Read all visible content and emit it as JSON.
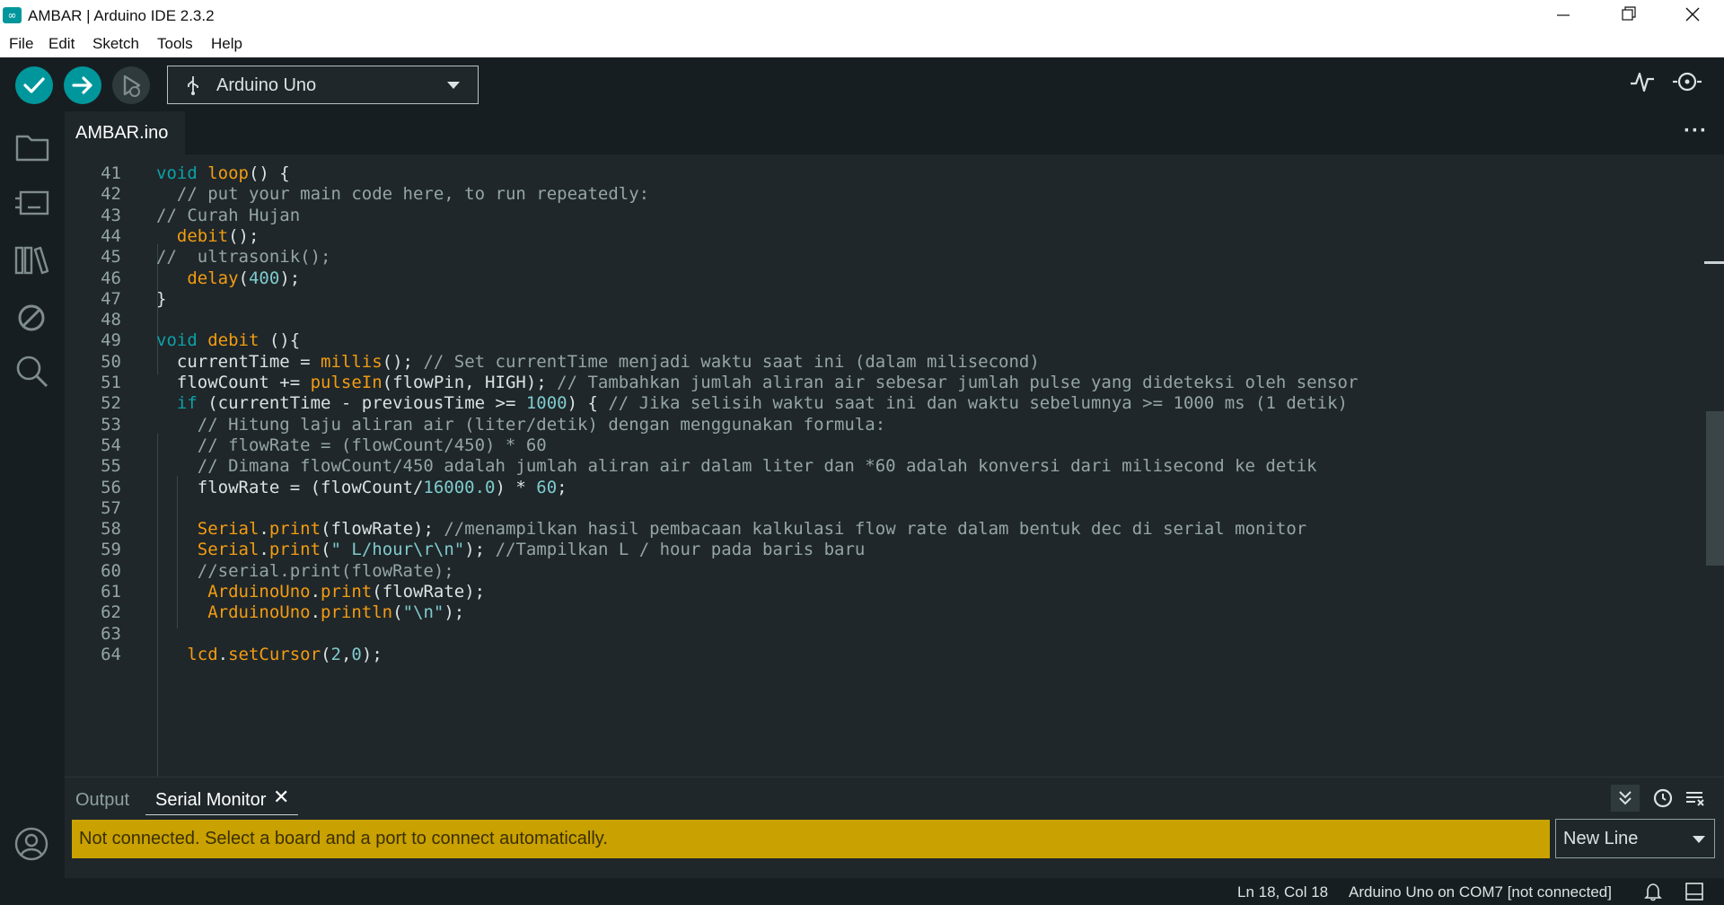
{
  "window": {
    "title": "AMBAR | Arduino IDE 2.3.2",
    "controls": [
      "minimize",
      "restore",
      "close"
    ]
  },
  "menu": [
    "File",
    "Edit",
    "Sketch",
    "Tools",
    "Help"
  ],
  "toolbar": {
    "verify": "verify-icon",
    "upload": "upload-icon",
    "debug": "debug-icon",
    "board": "Arduino Uno",
    "serial_plotter": "serial-plotter-icon",
    "serial_monitor": "serial-monitor-icon"
  },
  "sidebar": [
    "folder-icon",
    "boards-manager-icon",
    "library-icon",
    "debug-disabled-icon",
    "search-icon",
    "account-icon"
  ],
  "tabs": {
    "active": "AMBAR.ino",
    "more": "···"
  },
  "code": [
    {
      "n": "41",
      "tokens": [
        [
          "k",
          "void"
        ],
        [
          "",
          "  "
        ],
        [
          "f",
          "loop"
        ],
        [
          "",
          "() {"
        ]
      ]
    },
    {
      "n": "42",
      "tokens": [
        [
          "",
          "  "
        ],
        [
          "c",
          "// put your main code here, to run repeatedly:"
        ]
      ]
    },
    {
      "n": "43",
      "tokens": [
        [
          "c",
          "// Curah Hujan"
        ]
      ]
    },
    {
      "n": "44",
      "tokens": [
        [
          "",
          "  "
        ],
        [
          "f",
          "debit"
        ],
        [
          "",
          "();"
        ]
      ]
    },
    {
      "n": "45",
      "tokens": [
        [
          "c",
          "//  ultrasonik();"
        ]
      ]
    },
    {
      "n": "46",
      "tokens": [
        [
          "",
          "   "
        ],
        [
          "f",
          "delay"
        ],
        [
          "",
          "("
        ],
        [
          "n",
          "400"
        ],
        [
          "",
          ");"
        ]
      ]
    },
    {
      "n": "47",
      "tokens": [
        [
          "",
          "}"
        ]
      ]
    },
    {
      "n": "48",
      "tokens": []
    },
    {
      "n": "49",
      "tokens": [
        [
          "k",
          "void"
        ],
        [
          "",
          ""
        ],
        [
          "f",
          "debit"
        ],
        [
          "",
          " (){"
        ]
      ]
    },
    {
      "n": "50",
      "tokens": [
        [
          "",
          "  currentTime = "
        ],
        [
          "f",
          "millis"
        ],
        [
          "",
          "(); "
        ],
        [
          "c",
          "// Set currentTime menjadi waktu saat ini (dalam milisecond)"
        ]
      ]
    },
    {
      "n": "51",
      "tokens": [
        [
          "",
          "  flowCount += "
        ],
        [
          "f",
          "pulseIn"
        ],
        [
          "",
          "(flowPin, HIGH); "
        ],
        [
          "c",
          "// Tambahkan jumlah aliran air sebesar jumlah pulse yang dideteksi oleh sensor"
        ]
      ]
    },
    {
      "n": "52",
      "tokens": [
        [
          "",
          "  "
        ],
        [
          "k",
          "if"
        ],
        [
          "",
          " (currentTime - previousTime >= "
        ],
        [
          "n",
          "1000"
        ],
        [
          "",
          ") { "
        ],
        [
          "c",
          "// Jika selisih waktu saat ini dan waktu sebelumnya >= 1000 ms (1 detik)"
        ]
      ]
    },
    {
      "n": "53",
      "tokens": [
        [
          "",
          "    "
        ],
        [
          "c",
          "// Hitung laju aliran air (liter/detik) dengan menggunakan formula:"
        ]
      ]
    },
    {
      "n": "54",
      "tokens": [
        [
          "",
          "    "
        ],
        [
          "c",
          "// flowRate = (flowCount/450) * 60"
        ]
      ]
    },
    {
      "n": "55",
      "tokens": [
        [
          "",
          "    "
        ],
        [
          "c",
          "// Dimana flowCount/450 adalah jumlah aliran air dalam liter dan *60 adalah konversi dari milisecond ke detik"
        ]
      ]
    },
    {
      "n": "56",
      "tokens": [
        [
          "",
          "    flowRate = (flowCount/"
        ],
        [
          "n",
          "16000.0"
        ],
        [
          "",
          ") * "
        ],
        [
          "n",
          "60"
        ],
        [
          "",
          ";"
        ]
      ]
    },
    {
      "n": "57",
      "tokens": []
    },
    {
      "n": "58",
      "tokens": [
        [
          "",
          "    "
        ],
        [
          "f",
          "Serial"
        ],
        [
          "",
          "."
        ],
        [
          "f",
          "print"
        ],
        [
          "",
          "(flowRate); "
        ],
        [
          "c",
          "//menampilkan hasil pembacaan kalkulasi flow rate dalam bentuk dec di serial monitor"
        ]
      ]
    },
    {
      "n": "59",
      "tokens": [
        [
          "",
          "    "
        ],
        [
          "f",
          "Serial"
        ],
        [
          "",
          "."
        ],
        [
          "f",
          "print"
        ],
        [
          "",
          "("
        ],
        [
          "s",
          "\" L/hour\\r\\n\""
        ],
        [
          "",
          "); "
        ],
        [
          "c",
          "//Tampilkan L / hour pada baris baru"
        ]
      ]
    },
    {
      "n": "60",
      "tokens": [
        [
          "",
          "    "
        ],
        [
          "c",
          "//serial.print(flowRate);"
        ]
      ]
    },
    {
      "n": "61",
      "tokens": [
        [
          "",
          "     "
        ],
        [
          "f",
          "ArduinoUno"
        ],
        [
          "",
          "."
        ],
        [
          "f",
          "print"
        ],
        [
          "",
          "(flowRate);"
        ]
      ]
    },
    {
      "n": "62",
      "tokens": [
        [
          "",
          "     "
        ],
        [
          "f",
          "ArduinoUno"
        ],
        [
          "",
          "."
        ],
        [
          "f",
          "println"
        ],
        [
          "",
          "("
        ],
        [
          "s",
          "\"\\n\""
        ],
        [
          "",
          ");"
        ]
      ]
    },
    {
      "n": "63",
      "tokens": []
    },
    {
      "n": "64",
      "tokens": [
        [
          "",
          "   "
        ],
        [
          "f",
          "lcd"
        ],
        [
          "",
          "."
        ],
        [
          "f",
          "setCursor"
        ],
        [
          "",
          "("
        ],
        [
          "n",
          "2"
        ],
        [
          "",
          ","
        ],
        [
          "n",
          "0"
        ],
        [
          "",
          ");"
        ]
      ]
    }
  ],
  "panel": {
    "tab_output": "Output",
    "tab_serial": "Serial Monitor",
    "close": "✕",
    "notice": "Not connected. Select a board and a port to connect automatically.",
    "line_ending": "New Line"
  },
  "status": {
    "position": "Ln 18, Col 18",
    "board_port": "Arduino Uno on COM7 [not connected]"
  }
}
